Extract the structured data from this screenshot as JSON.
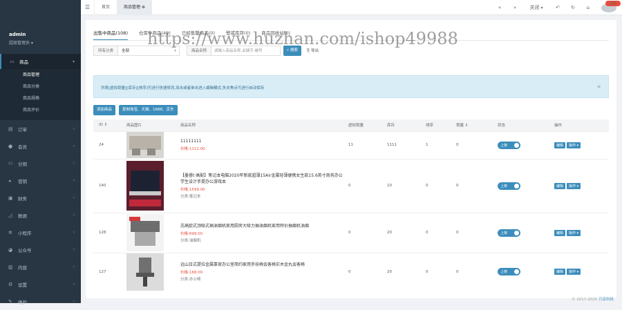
{
  "user": {
    "name": "admin",
    "role": "超级管理员"
  },
  "sidebar": {
    "active": {
      "label": "商品",
      "icon": "box-icon",
      "subitems": [
        "商品管理",
        "商品分类",
        "商品规格",
        "商品评价"
      ]
    },
    "items": [
      {
        "label": "订单",
        "icon": "order-icon"
      },
      {
        "label": "会员",
        "icon": "user-icon"
      },
      {
        "label": "分销",
        "icon": "share-icon"
      },
      {
        "label": "营销",
        "icon": "megaphone-icon"
      },
      {
        "label": "财务",
        "icon": "wallet-icon"
      },
      {
        "label": "数据",
        "icon": "chart-icon"
      },
      {
        "label": "小程序",
        "icon": "miniapp-icon"
      },
      {
        "label": "公众号",
        "icon": "wechat-icon"
      },
      {
        "label": "内容",
        "icon": "document-icon"
      },
      {
        "label": "设置",
        "icon": "gear-icon"
      },
      {
        "label": "维护",
        "icon": "wrench-icon"
      }
    ]
  },
  "topbar": {
    "tab_home": "首页",
    "tab_current": "商品管理",
    "close_all": "关闭",
    "notify_count": "20"
  },
  "tabs": [
    "出售中商品(108)",
    "仓库中商品(49)",
    "已经售罄商品(0)",
    "警戒库存(0)",
    "商品回收站(0)"
  ],
  "filters": {
    "category_label": "所有分类",
    "category_value": "全部",
    "search_label": "商品名称",
    "search_placeholder": "请输入商品名称,关键字,编号",
    "search_btn": "搜索",
    "export_btn": "导出"
  },
  "alert": "列表[虚拟销量][库存][排序]可进行快速修改,双击或者单击进入编辑模式,失去焦点可进行自动保存",
  "buttons": {
    "add": "添加商品",
    "copy": "复制淘宝、天猫、1688、京东"
  },
  "table": {
    "headers": [
      "ID",
      "商品图片",
      "商品名称",
      "虚拟销量",
      "库存",
      "排序",
      "销量",
      "状态",
      "操作"
    ],
    "status_label": "上架",
    "edit_label": "编辑",
    "op_label": "操作",
    "rows": [
      {
        "id": "24",
        "name": "11111111",
        "price": "价格:1111.00",
        "category": "",
        "virtual_sales": "11",
        "stock": "1111",
        "sort": "1",
        "sales": "0"
      },
      {
        "id": "140",
        "name": "【墨睿t·高配】笔记本电脑2020年新款超薄15Air金属轻薄便携女生款15.6英寸商务办公学生设计手提办公游戏本",
        "price": "价格:1599.00",
        "category": "分类:笔记本",
        "virtual_sales": "0",
        "stock": "10",
        "sort": "0",
        "sales": "0"
      },
      {
        "id": "128",
        "name": "志高欧式顶吸式抽油烟机家用厨房大吸力抽油烟机家用特价抽烟机油烟",
        "price": "价格:699.00",
        "category": "分类:油烟机",
        "virtual_sales": "0",
        "stock": "20",
        "sort": "0",
        "sales": "0"
      },
      {
        "id": "127",
        "name": "远山日式提拉金属靠背办公室简约家用手扶椅会客椅实木金丸会客椅",
        "price": "价格:168.00",
        "category": "分类:办公椅",
        "virtual_sales": "0",
        "stock": "20",
        "sort": "0",
        "sales": "0"
      }
    ]
  },
  "footer": {
    "copyright": "© 2017-2020",
    "brand": "万店科技"
  },
  "watermark": "https://www.huzhan.com/ishop49988",
  "colors": {
    "primary": "#3c8dbc",
    "sidebar": "#283643",
    "danger": "#e74c3c"
  }
}
